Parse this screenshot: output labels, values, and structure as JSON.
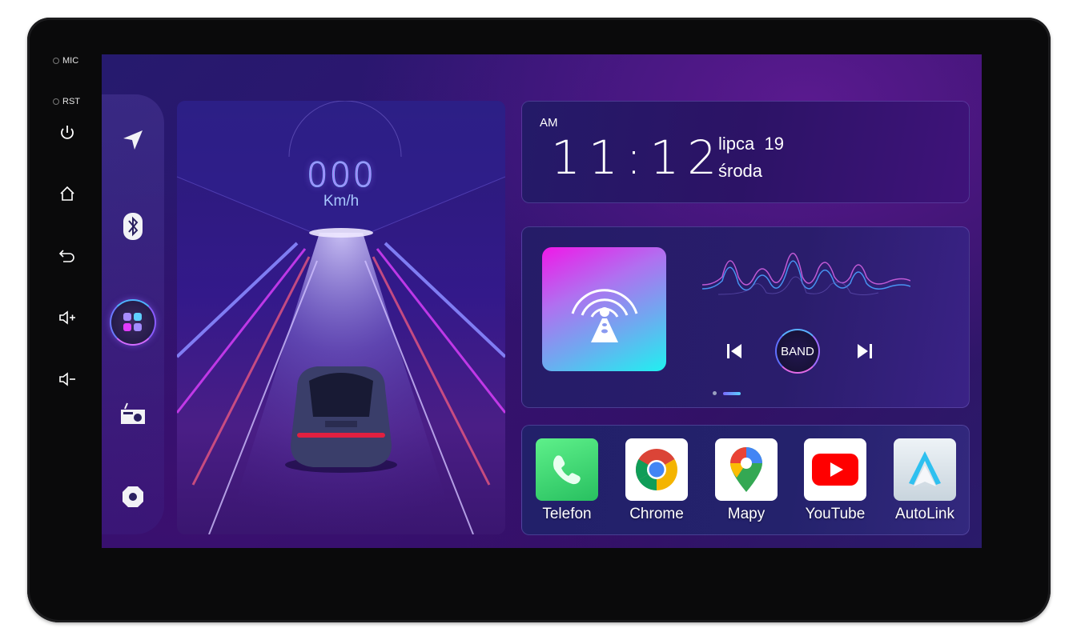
{
  "device": {
    "hardware_labels": {
      "mic": "MIC",
      "rst": "RST"
    },
    "hardware_buttons": [
      {
        "name": "power",
        "icon": "power-icon"
      },
      {
        "name": "home",
        "icon": "home-icon"
      },
      {
        "name": "back",
        "icon": "back-icon"
      },
      {
        "name": "volume-up",
        "icon": "volume-up-icon"
      },
      {
        "name": "volume-down",
        "icon": "volume-down-icon"
      }
    ]
  },
  "dock": {
    "items": [
      {
        "name": "navigation",
        "icon": "navigation-arrow-icon"
      },
      {
        "name": "bluetooth",
        "icon": "bluetooth-icon"
      },
      {
        "name": "apps",
        "icon": "apps-grid-icon",
        "active": true
      },
      {
        "name": "radio",
        "icon": "radio-icon"
      },
      {
        "name": "settings",
        "icon": "settings-hexagon-icon"
      }
    ]
  },
  "speedometer": {
    "value": "000",
    "unit": "Km/h"
  },
  "clock": {
    "meridiem": "AM",
    "time": "11:12",
    "month_day": "lipca  19",
    "weekday": "środa"
  },
  "radio": {
    "band_label": "BAND",
    "prev_icon": "skip-previous-icon",
    "next_icon": "skip-next-icon",
    "pages": 2,
    "active_page": 2
  },
  "apps": [
    {
      "label": "Telefon",
      "icon": "phone-icon"
    },
    {
      "label": "Chrome",
      "icon": "chrome-icon"
    },
    {
      "label": "Mapy",
      "icon": "maps-pin-icon"
    },
    {
      "label": "YouTube",
      "icon": "youtube-icon"
    },
    {
      "label": "AutoLink",
      "icon": "autolink-icon"
    }
  ]
}
